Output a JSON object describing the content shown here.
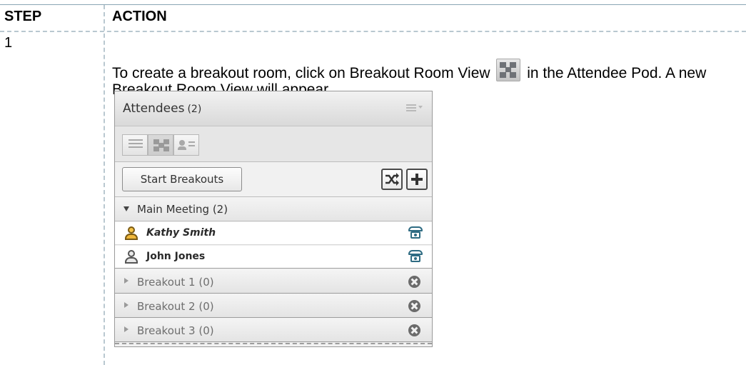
{
  "table": {
    "headers": {
      "step": "STEP",
      "action": "ACTION"
    },
    "rows": [
      {
        "step": "1",
        "text_before_icon": "To create a breakout room, click on Breakout Room View ",
        "icon": "breakout-room-view-icon",
        "text_after_icon": " in the Attendee Pod.  A new Breakout Room View will appear."
      }
    ]
  },
  "pod": {
    "title": "Attendees",
    "count": "(2)",
    "menu_icon": "pod-options-menu-icon",
    "view_buttons": [
      "attendee-list-view-icon",
      "breakout-room-view-icon",
      "attendee-status-view-icon"
    ],
    "start_button": "Start Breakouts",
    "main_meeting": "Main Meeting (2)",
    "attendees": [
      {
        "name": "Kathy Smith",
        "role": "host"
      },
      {
        "name": "John Jones",
        "role": "participant"
      }
    ],
    "breakouts": [
      "Breakout 1 (0)",
      "Breakout 2 (0)",
      "Breakout 3 (0)"
    ]
  }
}
